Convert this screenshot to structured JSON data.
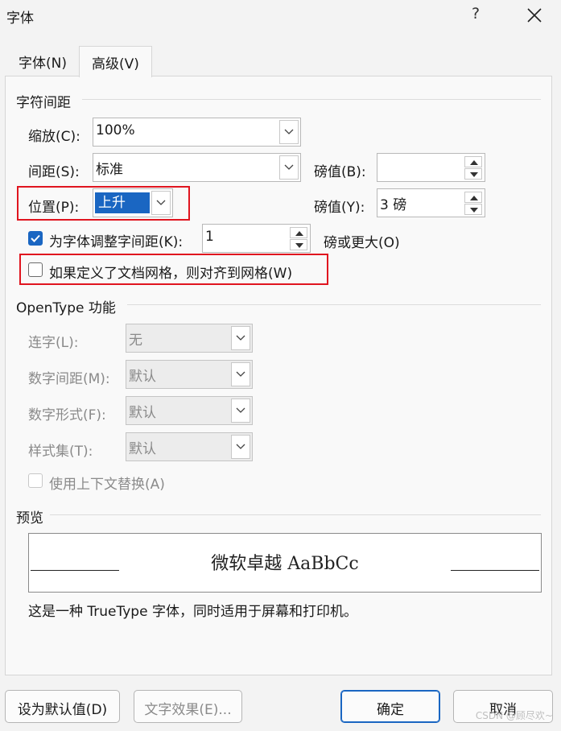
{
  "window": {
    "title": "字体",
    "help": "?"
  },
  "tabs": [
    {
      "label": "字体(N)"
    },
    {
      "label": "高级(V)"
    }
  ],
  "char_spacing": {
    "group_label": "字符间距",
    "scale": {
      "label": "缩放(C):",
      "value": "100%"
    },
    "spacing": {
      "label": "间距(S):",
      "value": "标准",
      "pt_label": "磅值(B):",
      "pt_value": ""
    },
    "position": {
      "label": "位置(P):",
      "value": "上升",
      "pt_label": "磅值(Y):",
      "pt_value": "3 磅"
    },
    "kerning": {
      "label": "为字体调整字间距(K):",
      "value": "1",
      "suffix": "磅或更大(O)",
      "checked": true
    },
    "snap_grid": {
      "label": "如果定义了文档网格，则对齐到网格(W)",
      "checked": false
    }
  },
  "opentype": {
    "group_label": "OpenType 功能",
    "ligatures": {
      "label": "连字(L):",
      "value": "无"
    },
    "num_spacing": {
      "label": "数字间距(M):",
      "value": "默认"
    },
    "num_forms": {
      "label": "数字形式(F):",
      "value": "默认"
    },
    "stylistic_sets": {
      "label": "样式集(T):",
      "value": "默认"
    },
    "contextual": {
      "label": "使用上下文替换(A)",
      "checked": false
    }
  },
  "preview": {
    "group_label": "预览",
    "sample": "微软卓越  AaBbCc",
    "note": "这是一种 TrueType 字体，同时适用于屏幕和打印机。"
  },
  "buttons": {
    "set_default": "设为默认值(D)",
    "text_effects": "文字效果(E)...",
    "ok": "确定",
    "cancel": "取消"
  },
  "watermark": "CSDN @顾尽欢~",
  "colors": {
    "accent": "#1a66c2",
    "highlight": "#e0151f"
  }
}
